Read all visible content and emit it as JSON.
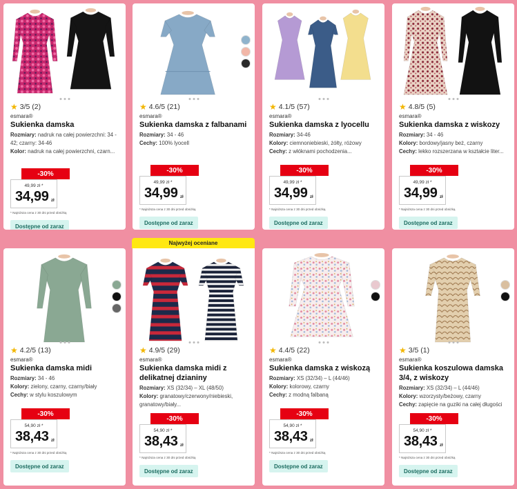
{
  "badge": "Najwyżej oceniane",
  "products": [
    {
      "rating": "3/5 (2)",
      "brand": "esmara®",
      "title": "Sukienka damska",
      "attrs": [
        {
          "label": "Rozmiary:",
          "value": "nadruk na całej powierzchni: 34 - 42; czarny: 34-46"
        },
        {
          "label": "Kolor:",
          "value": "nadruk na całej powierzchni, czarn..."
        }
      ],
      "discount": "-30%",
      "old_price": "49,99 zł *",
      "price": "34,99",
      "currency": "zł",
      "note": "* Najniższa cena z 30 dni przed obniżką",
      "availability": "Dostępne od zaraz",
      "swatches": []
    },
    {
      "rating": "4.6/5 (21)",
      "brand": "esmara®",
      "title": "Sukienka damska z falbanami",
      "attrs": [
        {
          "label": "Rozmiary:",
          "value": "34 - 46"
        },
        {
          "label": "Cechy:",
          "value": "100% lyocell"
        }
      ],
      "discount": "-30%",
      "old_price": "49,99 zł *",
      "price": "34,99",
      "currency": "zł",
      "note": "* Najniższa cena z 30 dni przed obniżką",
      "availability": "Dostępne od zaraz",
      "swatches": [
        "#8fb3cc",
        "#f2b7a8",
        "#2a2a2a"
      ]
    },
    {
      "rating": "4.1/5 (57)",
      "brand": "esmara®",
      "title": "Sukienka damska z lyocellu",
      "attrs": [
        {
          "label": "Rozmiary:",
          "value": "34-46"
        },
        {
          "label": "Kolory:",
          "value": "ciemnoniebieski, żółty, różowy"
        },
        {
          "label": "Cechy:",
          "value": "z włóknami pochodzenia..."
        }
      ],
      "discount": "-30%",
      "old_price": "49,99 zł *",
      "price": "34,99",
      "currency": "zł",
      "note": "* Najniższa cena z 30 dni przed obniżką",
      "availability": "Dostępne od zaraz",
      "swatches": []
    },
    {
      "rating": "4.8/5 (5)",
      "brand": "esmara®",
      "title": "Sukienka damska z wiskozy",
      "attrs": [
        {
          "label": "Rozmiary:",
          "value": "34 - 46"
        },
        {
          "label": "Kolory:",
          "value": "bordowy/jasny beż, czarny"
        },
        {
          "label": "Cechy:",
          "value": "lekko rozszerzana w kształcie liter..."
        }
      ],
      "discount": "-30%",
      "old_price": "49,99 zł *",
      "price": "34,99",
      "currency": "zł",
      "note": "* Najniższa cena z 30 dni przed obniżką",
      "availability": "Dostępne od zaraz",
      "swatches": []
    },
    {
      "rating": "4.2/5 (13)",
      "brand": "esmara®",
      "title": "Sukienka damska midi",
      "attrs": [
        {
          "label": "Rozmiary:",
          "value": "34 - 46"
        },
        {
          "label": "Kolory:",
          "value": "zielony, czarny, czarny/biały"
        },
        {
          "label": "Cechy:",
          "value": "w stylu koszulowym"
        }
      ],
      "discount": "-30%",
      "old_price": "54,90 zł *",
      "price": "38,43",
      "currency": "zł",
      "note": "* Najniższa cena z 30 dni przed obniżką",
      "availability": "Dostępne od zaraz",
      "swatches": [
        "#8aa893",
        "#111111",
        "#666666"
      ]
    },
    {
      "rating": "4.9/5 (29)",
      "brand": "esmara®",
      "title": "Sukienka damska midi z delikatnej dzianiny",
      "attrs": [
        {
          "label": "Rozmiary:",
          "value": "XS (32/34) – XL (48/50)"
        },
        {
          "label": "Kolory:",
          "value": "granatowy/czerwony/niebieski, granatowy/biały..."
        }
      ],
      "discount": "-30%",
      "old_price": "54,90 zł *",
      "price": "38,43",
      "currency": "zł",
      "note": "* Najniższa cena z 30 dni przed obniżką",
      "availability": "Dostępne od zaraz",
      "swatches": []
    },
    {
      "rating": "4.4/5 (22)",
      "brand": "esmara®",
      "title": "Sukienka damska z wiskozą",
      "attrs": [
        {
          "label": "Rozmiary:",
          "value": "XS (32/34) – L (44/46)"
        },
        {
          "label": "Kolory:",
          "value": "kolorowy, czarny"
        },
        {
          "label": "Cechy:",
          "value": "z modną falbaną"
        }
      ],
      "discount": "-30%",
      "old_price": "54,90 zł *",
      "price": "38,43",
      "currency": "zł",
      "note": "* Najniższa cena z 30 dni przed obniżką",
      "availability": "Dostępne od zaraz",
      "swatches": [
        "#e9c9cf",
        "#111111"
      ]
    },
    {
      "rating": "3/5 (1)",
      "brand": "esmara®",
      "title": "Sukienka koszulowa damska 3/4, z wiskozy",
      "attrs": [
        {
          "label": "Rozmiary:",
          "value": "XS (32/34) – L (44/46)"
        },
        {
          "label": "Kolory:",
          "value": "wzorzysty/beżowy, czarny"
        },
        {
          "label": "Cechy:",
          "value": "zapięcie na guziki na całej długości"
        }
      ],
      "discount": "-30%",
      "old_price": "54,90 zł *",
      "price": "38,43",
      "currency": "zł",
      "note": "* Najniższa cena z 30 dni przed obniżką",
      "availability": "Dostępne od zaraz",
      "swatches": [
        "#d9bfa0",
        "#111111"
      ]
    }
  ]
}
